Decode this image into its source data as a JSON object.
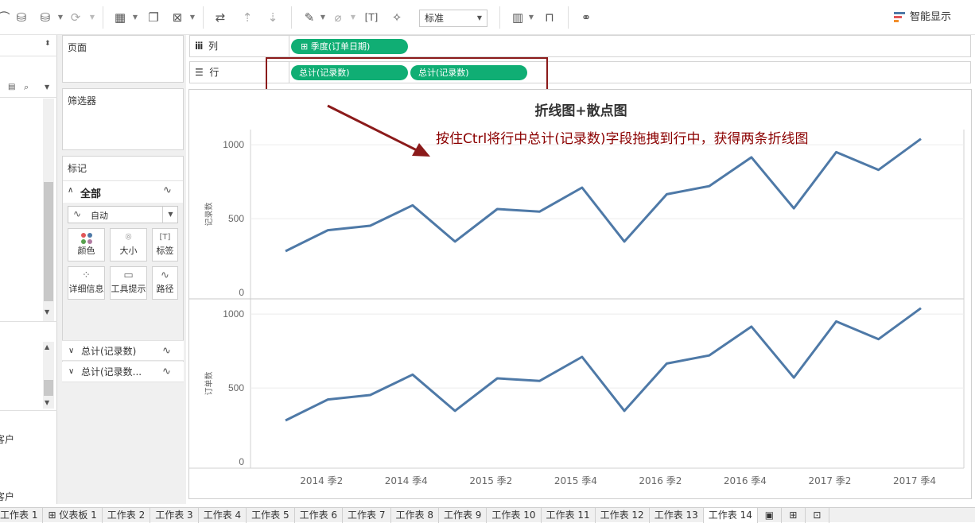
{
  "toolbar": {
    "icons": [
      "new-data-source-icon",
      "pause-updates-icon",
      "refresh-icon",
      "new-worksheet-icon",
      "duplicate-sheet-icon",
      "clear-sheet-icon",
      "swap-rows-columns-icon",
      "sort-ascending-icon",
      "sort-descending-icon",
      "highlight-icon",
      "group-icon",
      "show-labels-icon",
      "pin-icon",
      "show-cards-icon",
      "presentation-mode-icon",
      "share-icon"
    ],
    "fit_value": "标准",
    "smart_show_label": "智能显示"
  },
  "pages_title": "页面",
  "filters_title": "筛选器",
  "marks": {
    "title": "标记",
    "all_label": "全部",
    "mark_type": "自动",
    "buttons": [
      {
        "label": "颜色",
        "icon": "color-dots-icon"
      },
      {
        "label": "大小",
        "icon": "size-icon"
      },
      {
        "label": "标签",
        "icon": "label-icon"
      },
      {
        "label": "详细信息",
        "icon": "detail-icon"
      },
      {
        "label": "工具提示",
        "icon": "tooltip-icon"
      },
      {
        "label": "路径",
        "icon": "path-icon"
      }
    ],
    "sub_cards": [
      "总计(记录数)",
      "总计(记录数..."
    ]
  },
  "data_pane": {
    "customers": [
      "客户",
      "客户"
    ]
  },
  "shelves": {
    "columns_label": "列",
    "rows_label": "行",
    "columns_pills": [
      "季度(订单日期)"
    ],
    "rows_pills": [
      "总计(记录数)",
      "总计(记录数)"
    ]
  },
  "chart_data": {
    "type": "line",
    "title": "折线图+散点图",
    "annotation": "按住Ctrl将行中总计(记录数)字段拖拽到行中，获得两条折线图",
    "categories": [
      "2014 季1",
      "2014 季2",
      "2014 季3",
      "2014 季4",
      "2015 季1",
      "2015 季2",
      "2015 季3",
      "2015 季4",
      "2016 季1",
      "2016 季2",
      "2016 季3",
      "2016 季4",
      "2017 季1",
      "2017 季2",
      "2017 季3",
      "2017 季4"
    ],
    "x_tick_labels": [
      "2014 季2",
      "2014 季4",
      "2015 季2",
      "2015 季4",
      "2016 季2",
      "2016 季4",
      "2017 季2",
      "2017 季4"
    ],
    "panes": [
      {
        "ylabel": "记录数",
        "yticks": [
          0,
          500,
          1000
        ],
        "ylim": [
          0,
          1060
        ],
        "values": [
          280,
          422,
          452,
          590,
          345,
          565,
          548,
          710,
          345,
          665,
          720,
          915,
          570,
          950,
          830,
          1040
        ]
      },
      {
        "ylabel": "订单数",
        "yticks": [
          0,
          500,
          1000
        ],
        "ylim": [
          0,
          1060
        ],
        "values": [
          280,
          422,
          452,
          590,
          345,
          565,
          548,
          710,
          345,
          665,
          720,
          915,
          570,
          950,
          830,
          1040
        ]
      }
    ],
    "line_color": "#4e79a7",
    "grid": true
  },
  "tabs": [
    {
      "label": "工作表 1",
      "icon": ""
    },
    {
      "label": "仪表板 1",
      "icon": "dashboard-icon"
    },
    {
      "label": "工作表 2",
      "icon": ""
    },
    {
      "label": "工作表 3",
      "icon": ""
    },
    {
      "label": "工作表 4",
      "icon": ""
    },
    {
      "label": "工作表 5",
      "icon": ""
    },
    {
      "label": "工作表 6",
      "icon": ""
    },
    {
      "label": "工作表 7",
      "icon": ""
    },
    {
      "label": "工作表 8",
      "icon": ""
    },
    {
      "label": "工作表 9",
      "icon": ""
    },
    {
      "label": "工作表 10",
      "icon": ""
    },
    {
      "label": "工作表 11",
      "icon": ""
    },
    {
      "label": "工作表 12",
      "icon": ""
    },
    {
      "label": "工作表 13",
      "icon": ""
    },
    {
      "label": "工作表 14",
      "icon": "",
      "active": true
    }
  ],
  "colors": {
    "pill_green": "#10ae74",
    "annotation_red": "#8b0000",
    "line_blue": "#4e79a7"
  }
}
